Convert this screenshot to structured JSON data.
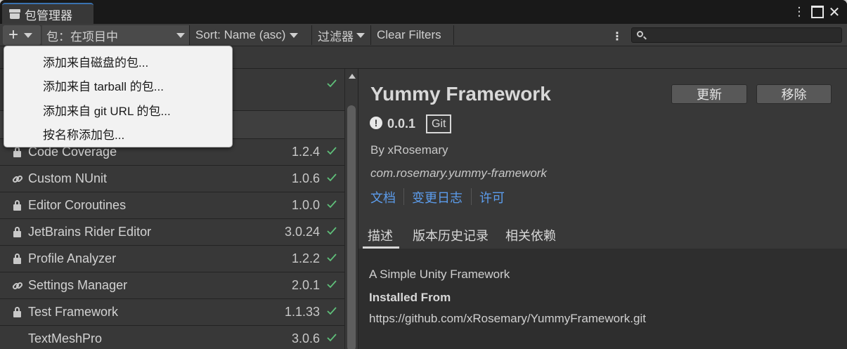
{
  "window": {
    "tab_title": "包管理器"
  },
  "toolbar": {
    "packages_label": "包：在项目中",
    "sort_label": "Sort: Name (asc)",
    "filters_label": "过滤器",
    "clear_filters_label": "Clear Filters",
    "search_placeholder": ""
  },
  "add_menu": {
    "items": [
      {
        "label": "添加来自磁盘的包..."
      },
      {
        "label": "添加来自 tarball 的包..."
      },
      {
        "label": "添加来自 git URL 的包..."
      },
      {
        "label": "按名称添加包..."
      }
    ]
  },
  "package_list": {
    "rows": [
      {
        "icon": "lock-icon",
        "name": "Code Coverage",
        "version": "1.2.4"
      },
      {
        "icon": "link-icon",
        "name": "Custom NUnit",
        "version": "1.0.6"
      },
      {
        "icon": "lock-icon",
        "name": "Editor Coroutines",
        "version": "1.0.0"
      },
      {
        "icon": "lock-icon",
        "name": "JetBrains Rider Editor",
        "version": "3.0.24"
      },
      {
        "icon": "lock-icon",
        "name": "Profile Analyzer",
        "version": "1.2.2"
      },
      {
        "icon": "link-icon",
        "name": "Settings Manager",
        "version": "2.0.1"
      },
      {
        "icon": "lock-icon",
        "name": "Test Framework",
        "version": "1.1.33"
      },
      {
        "icon": "",
        "name": "TextMeshPro",
        "version": "3.0.6"
      }
    ]
  },
  "details": {
    "title": "Yummy Framework",
    "update_label": "更新",
    "remove_label": "移除",
    "version": "0.0.1",
    "source_badge": "Git",
    "author": "By xRosemary",
    "package_id": "com.rosemary.yummy-framework",
    "links": [
      "文档",
      "变更日志",
      "许可"
    ],
    "tabs": [
      "描述",
      "版本历史记录",
      "相关依赖"
    ],
    "selected_tab": "描述",
    "description": "A Simple Unity Framework",
    "installed_from_label": "Installed From",
    "installed_from_url": "https://github.com/xRosemary/YummyFramework.git"
  },
  "colors": {
    "accent_link": "#5c9ded",
    "check": "#5fc07a",
    "background": "#383838"
  }
}
